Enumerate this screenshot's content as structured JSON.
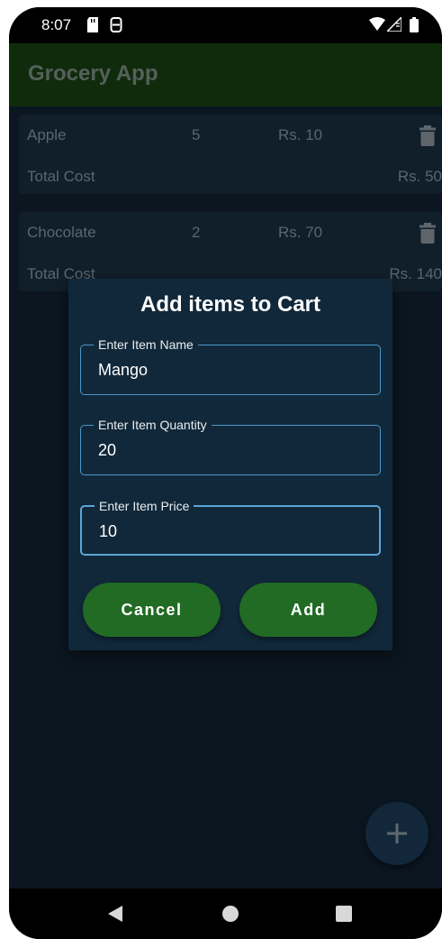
{
  "status_bar": {
    "time": "8:07"
  },
  "app_bar": {
    "title": "Grocery App"
  },
  "cart_items": [
    {
      "name": "Apple",
      "quantity": "5",
      "price": "Rs. 10",
      "total_label": "Total Cost",
      "total_value": "Rs. 50"
    },
    {
      "name": "Chocolate",
      "quantity": "2",
      "price": "Rs. 70",
      "total_label": "Total Cost",
      "total_value": "Rs. 140"
    }
  ],
  "dialog": {
    "title": "Add items to Cart",
    "fields": [
      {
        "label": "Enter Item Name",
        "value": "Mango"
      },
      {
        "label": "Enter Item Quantity",
        "value": "20"
      },
      {
        "label": "Enter Item Price",
        "value": "10"
      }
    ],
    "cancel_label": "Cancel",
    "add_label": "Add"
  },
  "colors": {
    "app_bar": "#0f2b0c",
    "background": "#0b1620",
    "card": "#111f2a",
    "dialog": "#11283a",
    "button": "#216b25",
    "field_border": "#4c98c8"
  },
  "icons": {
    "delete": "trash-icon",
    "fab": "plus-icon",
    "nav_back": "triangle-back-icon",
    "nav_home": "circle-home-icon",
    "nav_recents": "square-recents-icon"
  }
}
